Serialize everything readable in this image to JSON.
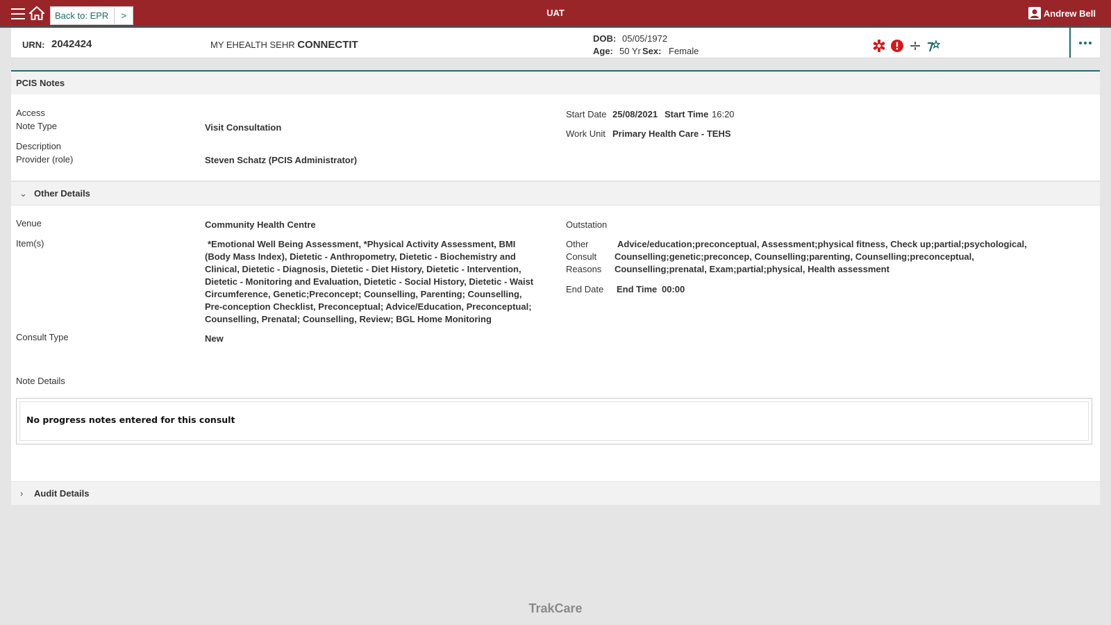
{
  "topbar": {
    "back_label": "Back to: EPR",
    "back_chevron": ">",
    "environment": "UAT",
    "user_name": "Andrew Bell",
    "icons": [
      "menu-icon",
      "home-icon",
      "user-icon"
    ],
    "accent_color": "#9a2529"
  },
  "banner": {
    "urn_label": "URN:",
    "urn_value": "2042424",
    "name_prefix": "MY EHEALTH SEHR ",
    "name_last": "CONNECTIT",
    "dob_label": "DOB:",
    "dob_value": "05/05/1972",
    "age_label": "Age:",
    "age_value": "50 Yr",
    "sex_label": "Sex:",
    "sex_value": "Female",
    "alert_icons": [
      "medical-alert-icon",
      "warning-icon",
      "divider-icon",
      "family-icon"
    ],
    "more_icon": "more-icon"
  },
  "notes": {
    "title": "PCIS Notes",
    "access_label": "Access",
    "note_type_label": "Note Type",
    "note_type_value": "Visit Consultation",
    "description_label": "Description",
    "provider_label": "Provider (role)",
    "provider_value": "Steven Schatz (PCIS Administrator)",
    "start_date_label": "Start Date",
    "start_date_value": "25/08/2021",
    "start_time_label": "Start Time",
    "start_time_value": "16:20",
    "work_unit_label": "Work Unit",
    "work_unit_value": "Primary Health Care - TEHS"
  },
  "other_details": {
    "title": "Other Details",
    "venue_label": "Venue",
    "venue_value": "Community Health Centre",
    "items_label": "Item(s)",
    "items_value": "*Emotional Well Being Assessment, *Physical Activity Assessment, BMI (Body Mass Index), Dietetic - Anthropometry, Dietetic - Biochemistry and Clinical, Dietetic - Diagnosis, Dietetic - Diet History, Dietetic - Intervention, Dietetic - Monitoring and Evaluation, Dietetic - Social History, Dietetic - Waist Circumference, Genetic;Preconcept; Counselling, Parenting; Counselling, Pre-conception Checklist, Preconceptual; Advice/Education, Preconceptual; Counselling, Prenatal; Counselling, Review; BGL Home Monitoring",
    "consult_type_label": "Consult Type",
    "consult_type_value": "New",
    "outstation_label": "Outstation",
    "other_reasons_label": "Other Consult Reasons",
    "other_reasons_value": "Advice/education;preconceptual, Assessment;physical fitness, Check up;partial;psychological, Counselling;genetic;preconcep, Counselling;parenting, Counselling;preconceptual, Counselling;prenatal, Exam;partial;physical, Health assessment",
    "end_date_label": "End Date",
    "end_time_label": "End Time",
    "end_time_value": "00:00",
    "note_details_label": "Note Details",
    "note_text": "No progress notes entered for this consult"
  },
  "audit": {
    "title": "Audit Details"
  },
  "footer": {
    "brand": "TrakCare"
  }
}
